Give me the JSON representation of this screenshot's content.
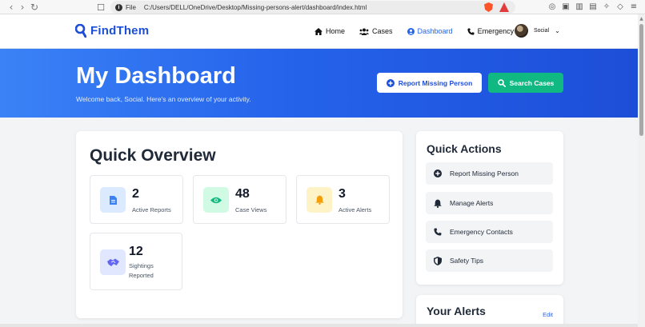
{
  "browser": {
    "file_label": "File",
    "url": "C:/Users/DELL/OneDrive/Desktop/Missing-persons-alert/dashboard/index.html"
  },
  "header": {
    "logo_text": "FindThem",
    "nav": [
      {
        "label": "Home",
        "icon": "home-icon"
      },
      {
        "label": "Cases",
        "icon": "users-icon"
      },
      {
        "label": "Dashboard",
        "icon": "user-circle-icon",
        "active": true
      },
      {
        "label": "Emergency",
        "icon": "phone-icon"
      }
    ],
    "user_name": "Social"
  },
  "hero": {
    "title": "My Dashboard",
    "subtitle": "Welcome back, Social. Here's an overview of your activity.",
    "report_button": "Report Missing Person",
    "search_button": "Search Cases"
  },
  "overview": {
    "title": "Quick Overview",
    "stats": [
      {
        "value": "2",
        "label": "Active Reports",
        "icon": "file-icon",
        "color": "#3b82f6"
      },
      {
        "value": "48",
        "label": "Case Views",
        "icon": "eye-icon",
        "color": "#10b981"
      },
      {
        "value": "3",
        "label": "Active Alerts",
        "icon": "bell-icon",
        "color": "#f59e0b"
      },
      {
        "value": "12",
        "label": "Sightings Reported",
        "icon": "handshake-icon",
        "color": "#6366f1"
      }
    ]
  },
  "quick_actions": {
    "title": "Quick Actions",
    "items": [
      {
        "label": "Report Missing Person",
        "icon": "plus-circle-icon"
      },
      {
        "label": "Manage Alerts",
        "icon": "bell-icon"
      },
      {
        "label": "Emergency Contacts",
        "icon": "phone-icon"
      },
      {
        "label": "Safety Tips",
        "icon": "shield-icon"
      }
    ]
  },
  "alerts": {
    "title": "Your Alerts",
    "edit_label": "Edit"
  },
  "colors": {
    "primary": "#2563eb",
    "success": "#10b981"
  }
}
